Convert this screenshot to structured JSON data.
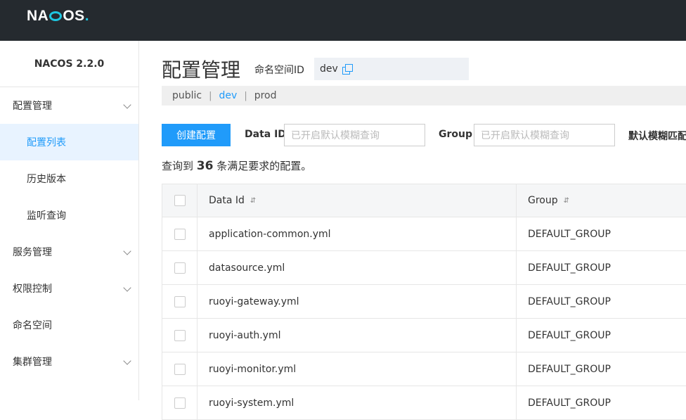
{
  "brand": {
    "logo_prefix": "NA",
    "logo_suffix": "OS",
    "logo_dot": "."
  },
  "sidebar": {
    "title": "NACOS 2.2.0",
    "items": [
      {
        "label": "配置管理",
        "expandable": true
      },
      {
        "label": "配置列表",
        "sub": true,
        "active": true
      },
      {
        "label": "历史版本",
        "sub": true
      },
      {
        "label": "监听查询",
        "sub": true
      },
      {
        "label": "服务管理",
        "expandable": true
      },
      {
        "label": "权限控制",
        "expandable": true
      },
      {
        "label": "命名空间"
      },
      {
        "label": "集群管理",
        "expandable": true
      }
    ]
  },
  "header": {
    "title": "配置管理",
    "namespace_label": "命名空间ID",
    "namespace_value": "dev"
  },
  "namespaces": {
    "items": [
      "public",
      "dev",
      "prod"
    ],
    "separator": "|",
    "active": "dev"
  },
  "toolbar": {
    "create_label": "创建配置",
    "data_id_label": "Data ID",
    "data_id_placeholder": "已开启默认模糊查询",
    "group_label": "Group",
    "group_placeholder": "已开启默认模糊查询",
    "fuzzy_label": "默认模糊匹配"
  },
  "result": {
    "prefix": "查询到",
    "count": "36",
    "suffix": "条满足要求的配置。"
  },
  "table": {
    "columns": [
      "Data Id",
      "Group"
    ],
    "sort_icon": "⇵",
    "rows": [
      {
        "data_id": "application-common.yml",
        "group": "DEFAULT_GROUP"
      },
      {
        "data_id": "datasource.yml",
        "group": "DEFAULT_GROUP"
      },
      {
        "data_id": "ruoyi-gateway.yml",
        "group": "DEFAULT_GROUP"
      },
      {
        "data_id": "ruoyi-auth.yml",
        "group": "DEFAULT_GROUP"
      },
      {
        "data_id": "ruoyi-monitor.yml",
        "group": "DEFAULT_GROUP"
      },
      {
        "data_id": "ruoyi-system.yml",
        "group": "DEFAULT_GROUP"
      }
    ]
  },
  "colors": {
    "topbar": "#252a2f",
    "accent": "#209bfa",
    "logo_accent": "#1ec6e0",
    "active_bg": "#e8f3ff"
  }
}
